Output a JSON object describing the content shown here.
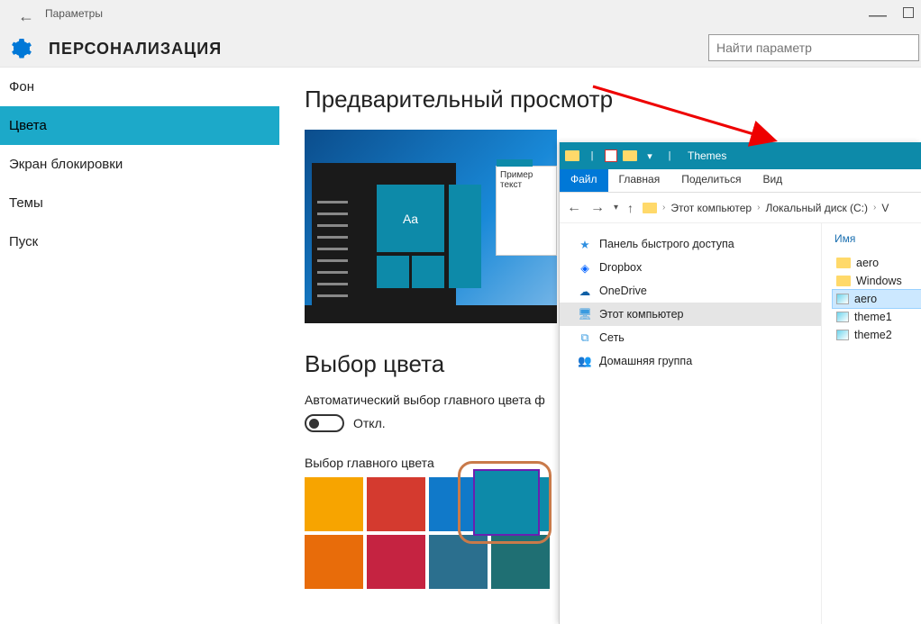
{
  "window": {
    "title": "Параметры",
    "page_title": "ПЕРСОНАЛИЗАЦИЯ",
    "search_placeholder": "Найти параметр"
  },
  "sidebar": {
    "items": [
      {
        "label": "Фон"
      },
      {
        "label": "Цвета"
      },
      {
        "label": "Экран блокировки"
      },
      {
        "label": "Темы"
      },
      {
        "label": "Пуск"
      }
    ]
  },
  "main": {
    "preview_title": "Предварительный просмотр",
    "preview_sample_text": "Пример текст",
    "preview_aa": "Aa",
    "color_section_title": "Выбор цвета",
    "auto_color_desc": "Автоматический выбор главного цвета ф",
    "toggle_off": "Откл.",
    "accent_label": "Выбор главного цвета",
    "colors_row1": [
      "#f7a400",
      "#d43a2f",
      "#1079c9",
      "#0d8aa9"
    ],
    "colors_row2": [
      "#e86c0a",
      "#c52341",
      "#2b6f8e",
      "#1f6f73"
    ]
  },
  "explorer": {
    "title": "Themes",
    "tabs": {
      "file": "Файл",
      "home": "Главная",
      "share": "Поделиться",
      "view": "Вид"
    },
    "breadcrumb": [
      "Этот компьютер",
      "Локальный диск (C:)"
    ],
    "tree": [
      {
        "label": "Панель быстрого доступа",
        "icon": "star",
        "color": "#2f8fe0"
      },
      {
        "label": "Dropbox",
        "icon": "dropbox",
        "color": "#0061ff"
      },
      {
        "label": "OneDrive",
        "icon": "cloud",
        "color": "#0f5fa5"
      },
      {
        "label": "Этот компьютер",
        "icon": "pc",
        "color": "#3a9be0",
        "selected": true
      },
      {
        "label": "Сеть",
        "icon": "net",
        "color": "#3a9be0"
      },
      {
        "label": "Домашняя группа",
        "icon": "home",
        "color": "#3aa04a"
      }
    ],
    "column_header": "Имя",
    "files": [
      {
        "label": "aero",
        "type": "folder"
      },
      {
        "label": "Windows",
        "type": "folder"
      },
      {
        "label": "aero",
        "type": "theme",
        "selected": true
      },
      {
        "label": "theme1",
        "type": "theme"
      },
      {
        "label": "theme2",
        "type": "theme"
      }
    ]
  }
}
